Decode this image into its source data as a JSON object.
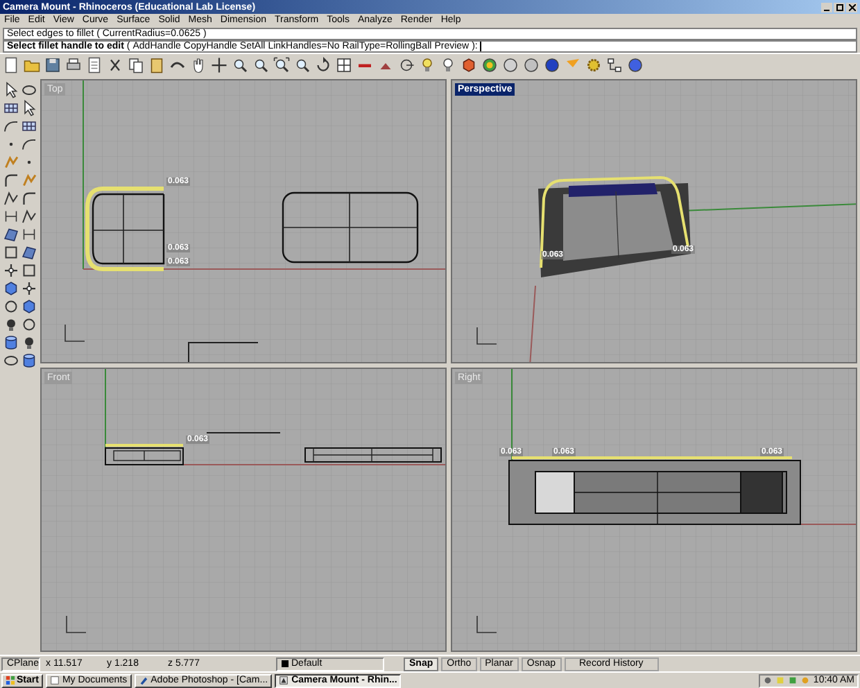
{
  "window": {
    "title": "Camera Mount - Rhinoceros (Educational Lab License)"
  },
  "menu": [
    "File",
    "Edit",
    "View",
    "Curve",
    "Surface",
    "Solid",
    "Mesh",
    "Dimension",
    "Transform",
    "Tools",
    "Analyze",
    "Render",
    "Help"
  ],
  "command_history": "Select edges to fillet ( CurrentRadius=0.0625 )",
  "command_prompt": {
    "label": "Select fillet handle to edit",
    "open": "(",
    "options": [
      "AddHandle",
      "CopyHandle",
      "SetAll",
      "LinkHandles=No",
      "RailType=RollingBall",
      "Preview"
    ],
    "close": "):"
  },
  "viewports": [
    {
      "title": "Top",
      "kind": "top",
      "selected": false,
      "labels": [
        "0.063",
        "0.063",
        "0.063"
      ]
    },
    {
      "title": "Perspective",
      "kind": "perspective",
      "selected": true,
      "labels": [
        "0.063",
        "0.063"
      ]
    },
    {
      "title": "Front",
      "kind": "front",
      "selected": false,
      "labels": [
        "0.063"
      ]
    },
    {
      "title": "Right",
      "kind": "right",
      "selected": false,
      "labels": [
        "0.063",
        "0.063",
        "0.063"
      ]
    }
  ],
  "status_bar": {
    "cplane": "CPlane",
    "x": "x 11.517",
    "y": "y 1.218",
    "z": "z 5.777",
    "layer": "Default",
    "toggles": [
      {
        "label": "Snap",
        "on": true
      },
      {
        "label": "Ortho",
        "on": false
      },
      {
        "label": "Planar",
        "on": false
      },
      {
        "label": "Osnap",
        "on": false
      },
      {
        "label": "Record History",
        "on": false
      }
    ]
  },
  "taskbar": {
    "start": "Start",
    "tasks": [
      {
        "label": "My Documents",
        "selected": false
      },
      {
        "label": "Adobe Photoshop - [Cam...",
        "selected": false
      },
      {
        "label": "Camera Mount - Rhin...",
        "selected": true
      }
    ],
    "clock": "10:40 AM"
  }
}
